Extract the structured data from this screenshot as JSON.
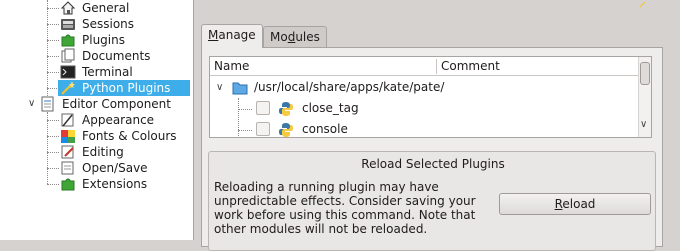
{
  "tree": {
    "items": [
      {
        "label": "General",
        "icon": "home-icon"
      },
      {
        "label": "Sessions",
        "icon": "sessions-icon"
      },
      {
        "label": "Plugins",
        "icon": "puzzle-icon"
      },
      {
        "label": "Documents",
        "icon": "documents-icon"
      },
      {
        "label": "Terminal",
        "icon": "terminal-icon"
      },
      {
        "label": "Python Plugins",
        "icon": "python-wand-icon",
        "selected": true
      },
      {
        "label": "Editor Component",
        "icon": "editor-icon"
      },
      {
        "label": "Appearance",
        "icon": "appearance-icon"
      },
      {
        "label": "Fonts & Colours",
        "icon": "fonts-colours-icon"
      },
      {
        "label": "Editing",
        "icon": "editing-icon"
      },
      {
        "label": "Open/Save",
        "icon": "open-save-icon"
      },
      {
        "label": "Extensions",
        "icon": "puzzle-icon"
      }
    ],
    "selection_color": "#3daee9"
  },
  "tabs": [
    {
      "label": "Manage",
      "mnemonic_prefix": "",
      "mnemonic": "M",
      "rest": "anage",
      "active": true
    },
    {
      "label": "Modules",
      "mnemonic_prefix": "Mo",
      "mnemonic": "d",
      "rest": "ules",
      "active": false
    }
  ],
  "plugin_list": {
    "columns": [
      "Name",
      "Comment"
    ],
    "root_path": "/usr/local/share/apps/kate/pate/",
    "plugins": [
      {
        "name": "close_tag",
        "checked": false
      },
      {
        "name": "console",
        "checked": false
      }
    ]
  },
  "reload": {
    "title": "Reload Selected Plugins",
    "description": "Reloading a running plugin may have unpredictable effects. Consider saving your work before using this command. Note that other modules will not be reloaded.",
    "button_mnemonic": "R",
    "button_rest": "eload"
  }
}
